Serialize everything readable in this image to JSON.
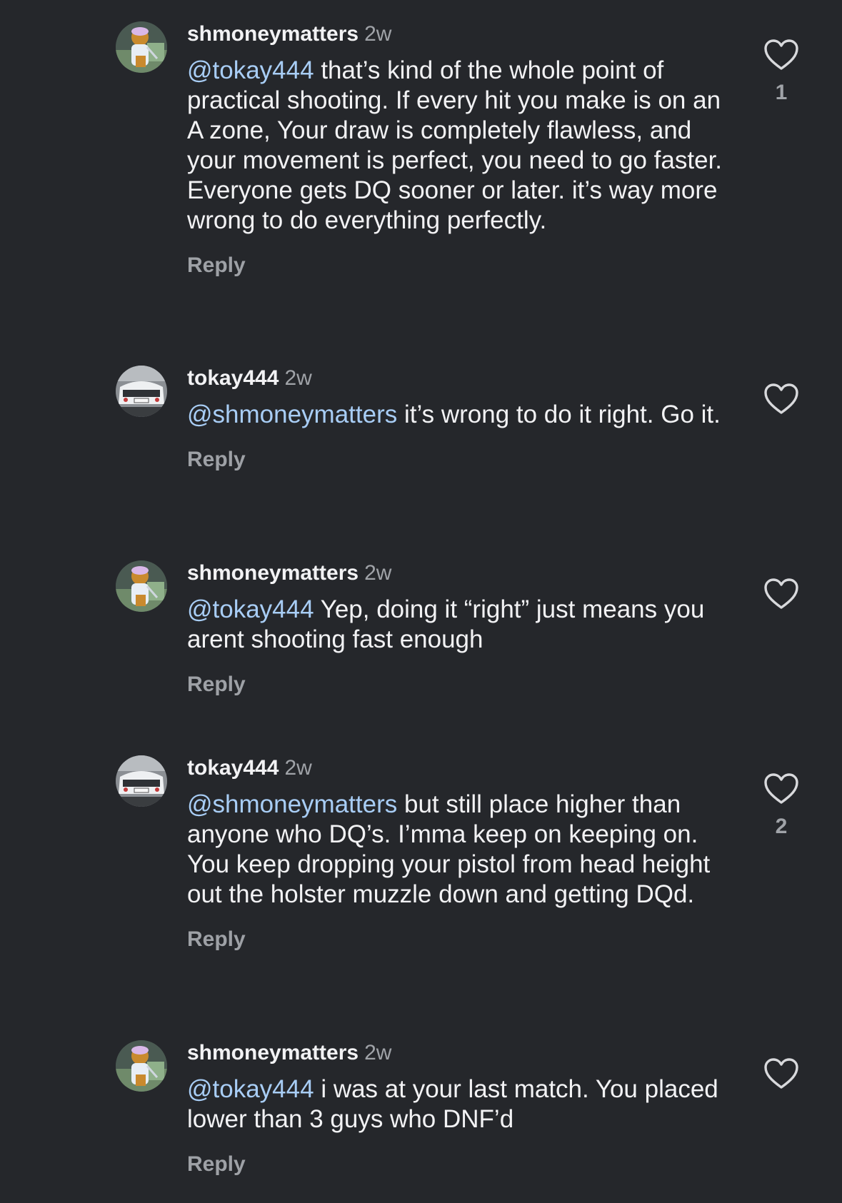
{
  "comments": [
    {
      "username": "shmoneymatters",
      "time": "2w",
      "mention": "@tokay444",
      "text": " that’s kind of the whole point of practical shooting. If every hit you make is on an A zone, Your draw is completely flawless, and your movement is perfect, you need to go faster. Everyone gets DQ sooner or later. it’s way more wrong to do everything perfectly.",
      "reply_label": "Reply",
      "like_count": "1",
      "avatar_icon": "bear-cartoon-avatar"
    },
    {
      "username": "tokay444",
      "time": "2w",
      "mention": "@shmoneymatters",
      "text": " it’s wrong to do it right. Go it.",
      "reply_label": "Reply",
      "like_count": "",
      "avatar_icon": "white-car-avatar"
    },
    {
      "username": "shmoneymatters",
      "time": "2w",
      "mention": "@tokay444",
      "text": " Yep, doing it “right” just means you arent shooting fast enough",
      "reply_label": "Reply",
      "like_count": "",
      "avatar_icon": "bear-cartoon-avatar"
    },
    {
      "username": "tokay444",
      "time": "2w",
      "mention": "@shmoneymatters",
      "text": " but still place higher than anyone who DQ’s. I’mma keep on keeping on. You keep dropping your pistol from head height out the holster muzzle down and getting DQd.",
      "reply_label": "Reply",
      "like_count": "2",
      "avatar_icon": "white-car-avatar"
    },
    {
      "username": "shmoneymatters",
      "time": "2w",
      "mention": "@tokay444",
      "text": " i was at your last match. You placed lower than 3 guys who DNF’d",
      "reply_label": "Reply",
      "like_count": "",
      "avatar_icon": "bear-cartoon-avatar"
    }
  ],
  "colors": {
    "background": "#25272b",
    "text": "#f2f2f4",
    "mention": "#a8cdf5",
    "secondary": "#a0a3a8"
  }
}
